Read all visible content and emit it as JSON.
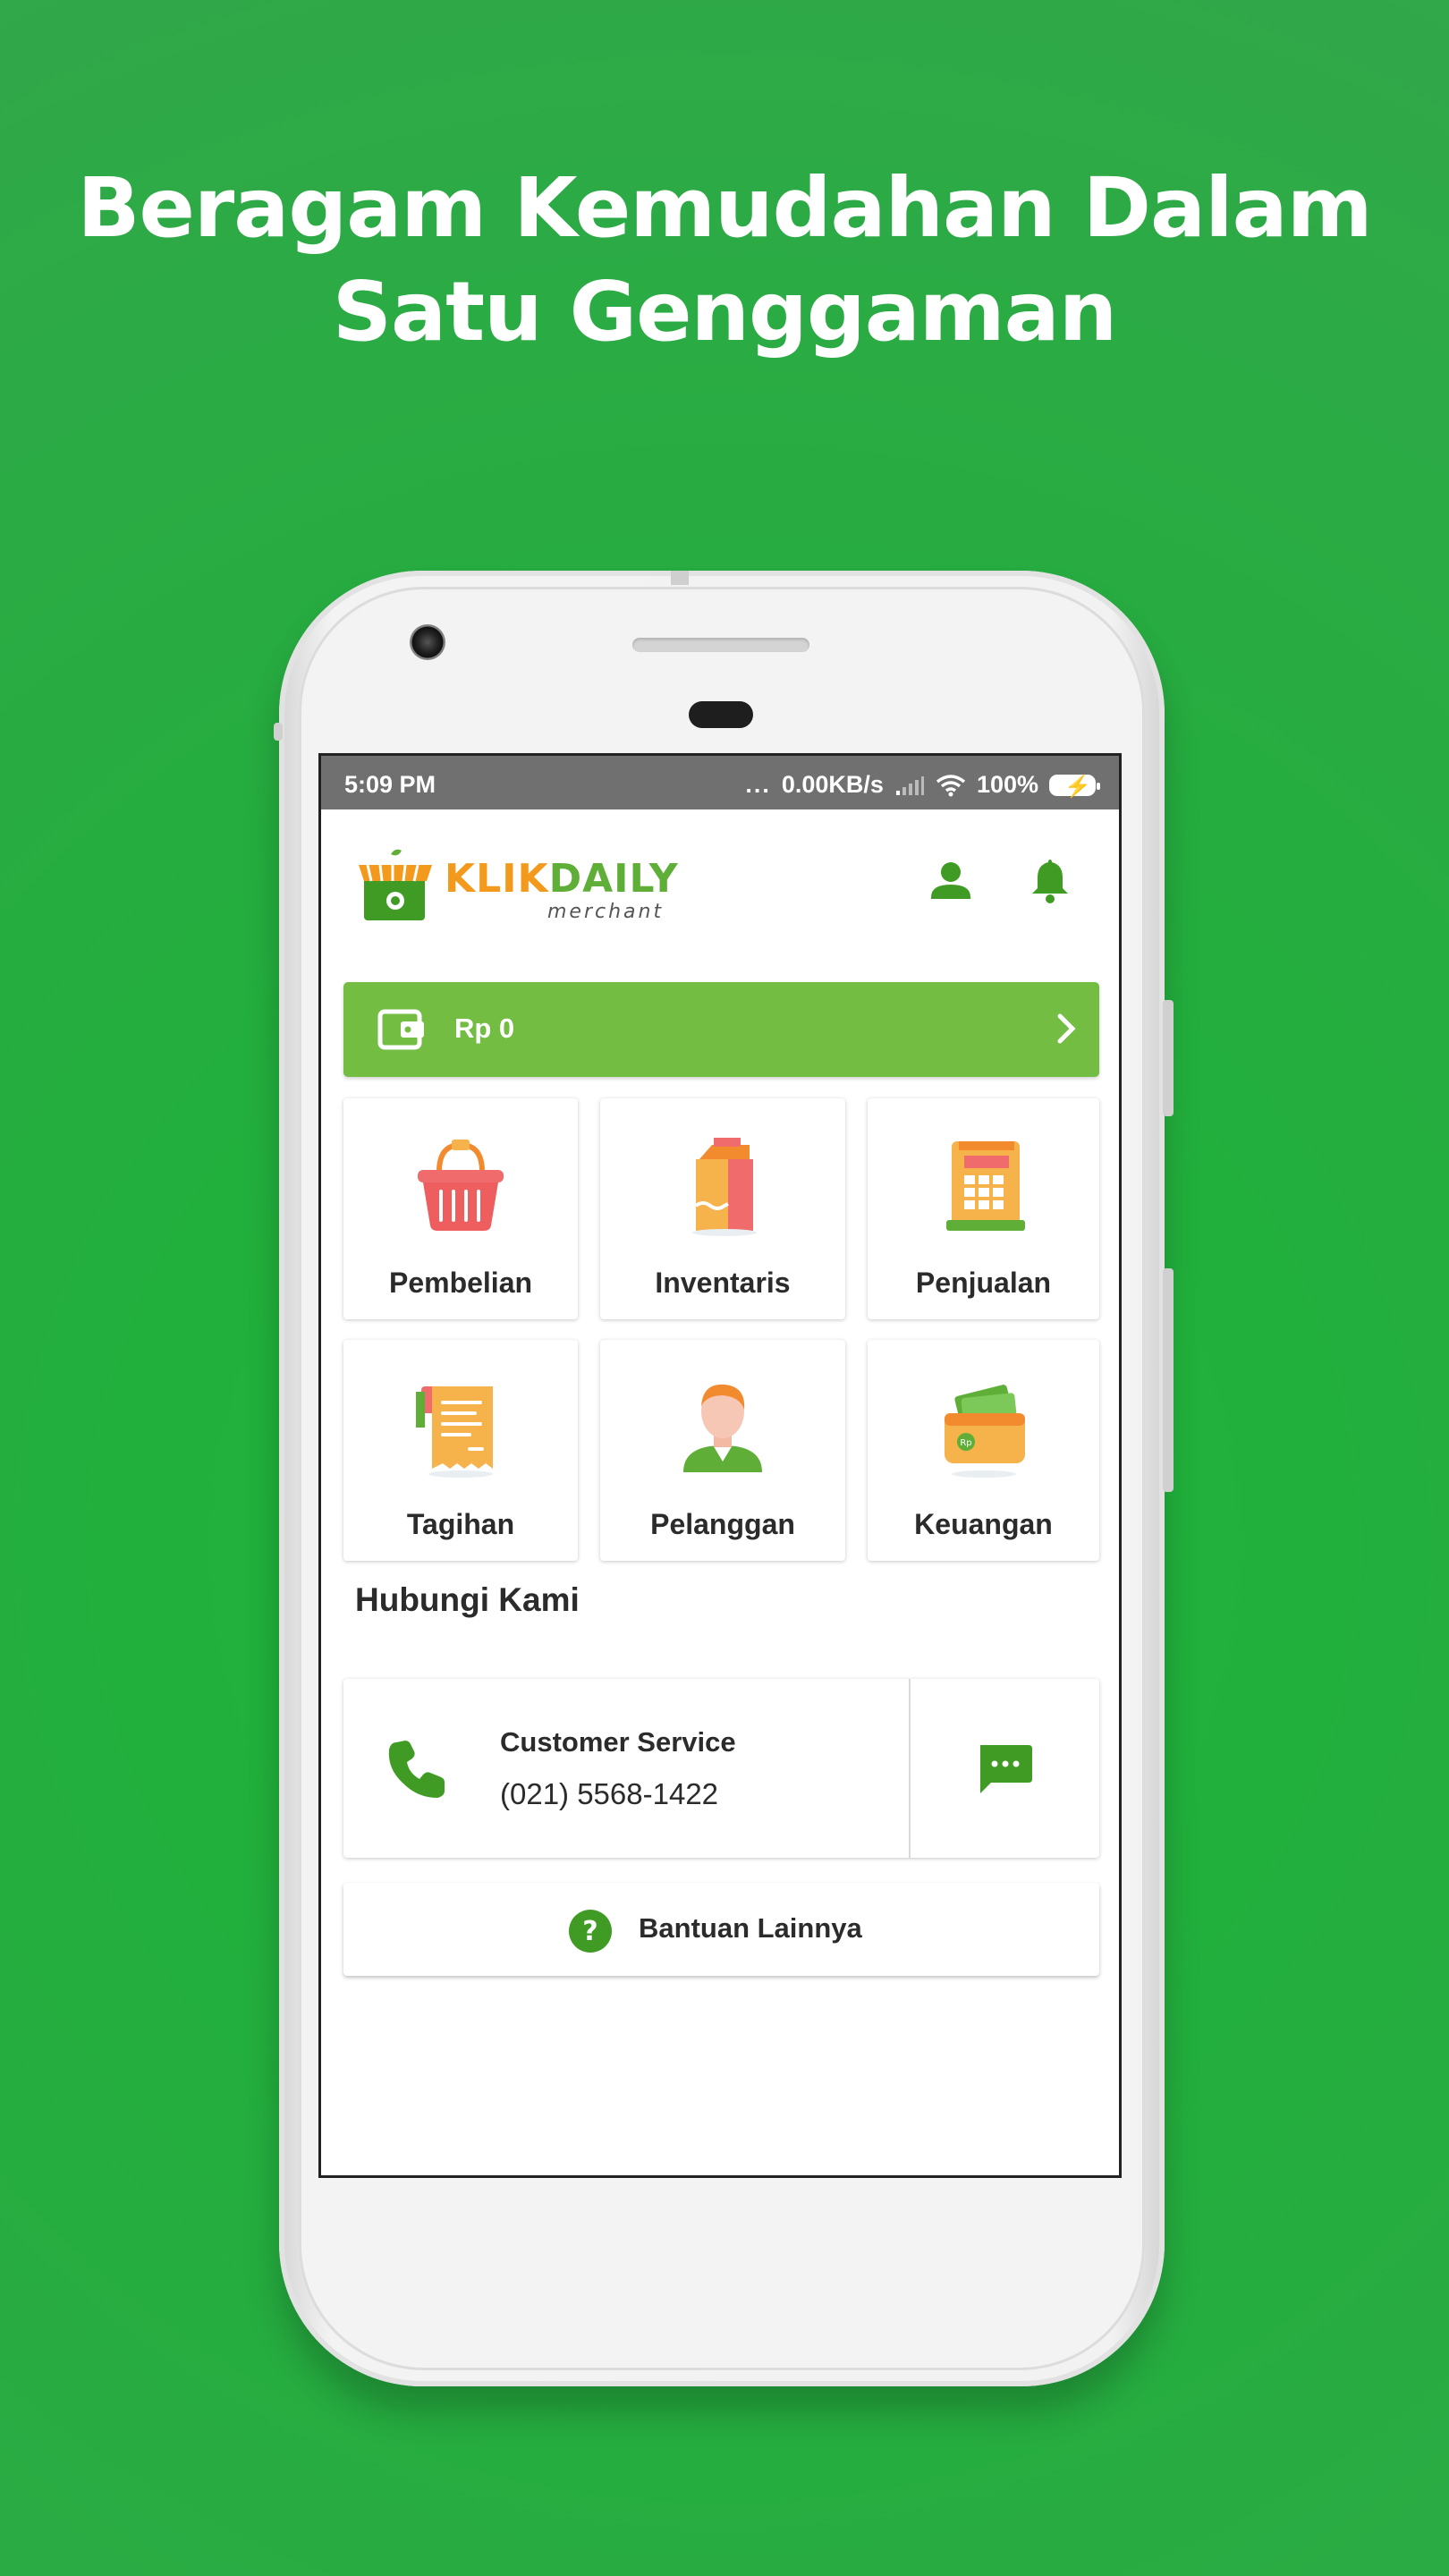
{
  "headline": {
    "line1": "Beragam Kemudahan Dalam",
    "line2": "Satu Genggaman"
  },
  "status_bar": {
    "time": "5:09 PM",
    "dots": "...",
    "network_speed": "0.00KB/s",
    "battery": "100%"
  },
  "app": {
    "logo": {
      "brand_part1": "KLIK",
      "brand_part2": "DAILY",
      "sub": "merchant"
    },
    "balance": {
      "amount": "Rp 0"
    },
    "menu": [
      {
        "label": "Pembelian",
        "icon": "basket-icon"
      },
      {
        "label": "Inventaris",
        "icon": "milk-carton-icon"
      },
      {
        "label": "Penjualan",
        "icon": "cash-register-icon"
      },
      {
        "label": "Tagihan",
        "icon": "receipt-icon"
      },
      {
        "label": "Pelanggan",
        "icon": "customer-icon"
      },
      {
        "label": "Keuangan",
        "icon": "wallet-icon"
      }
    ],
    "contact": {
      "title": "Hubungi Kami",
      "cs_name": "Customer Service",
      "cs_phone": "(021) 5568-1422"
    },
    "help": {
      "label": "Bantuan Lainnya"
    }
  },
  "colors": {
    "background": "#24ae3e",
    "accent_green": "#73bd43",
    "icon_green": "#3f9b23",
    "brand_orange": "#f39a1c"
  }
}
